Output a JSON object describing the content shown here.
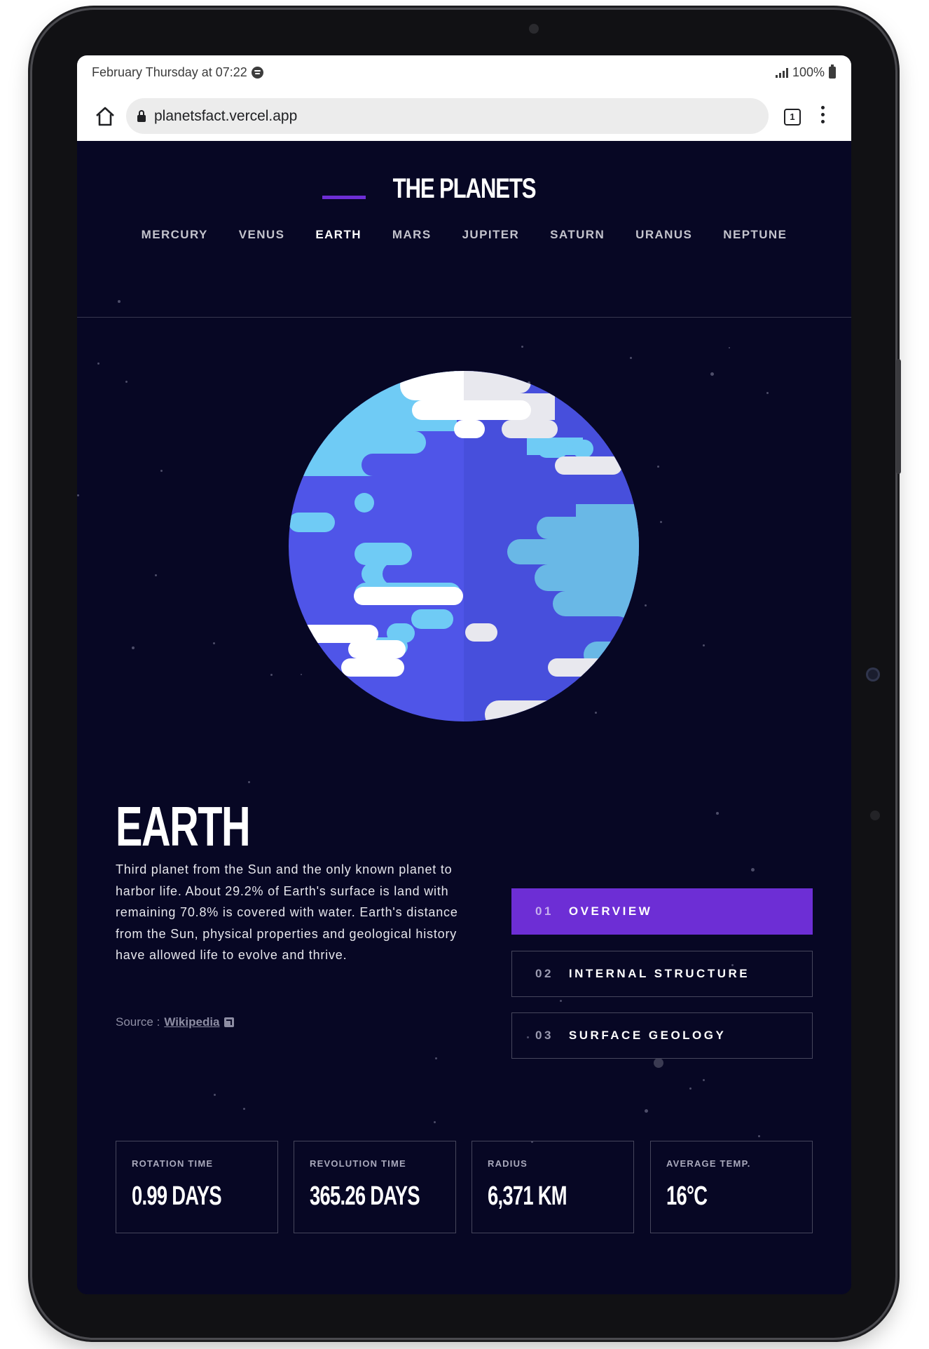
{
  "status_bar": {
    "datetime": "February Thursday at 07:22",
    "battery": "100%",
    "icons": [
      "spotify-icon",
      "signal-icon",
      "battery-icon"
    ]
  },
  "browser": {
    "url": "planetsfact.vercel.app",
    "tab_count": "1",
    "icons": [
      "home-icon",
      "lock-icon",
      "tabs-icon",
      "more-menu-icon"
    ]
  },
  "site": {
    "logo": "THE PLANETS",
    "nav": [
      "MERCURY",
      "VENUS",
      "EARTH",
      "MARS",
      "JUPITER",
      "SATURN",
      "URANUS",
      "NEPTUNE"
    ],
    "active_planet": "EARTH",
    "accent_color": "#6D2ED5",
    "background_color": "#070724"
  },
  "planet": {
    "name": "EARTH",
    "description": "Third planet from the Sun and the only known planet to harbor life. About 29.2% of Earth's surface is land with remaining 70.8% is covered with water. Earth's distance from the Sun, physical properties and geological history have allowed life to evolve and thrive.",
    "source_prefix": "Source :",
    "source_link": "Wikipedia",
    "colors": {
      "ocean": "#4F55E8",
      "land": "#6FCBF5",
      "clouds": "#FFFFFF"
    }
  },
  "tabs": [
    {
      "num": "01",
      "label": "OVERVIEW",
      "active": true
    },
    {
      "num": "02",
      "label": "INTERNAL STRUCTURE",
      "active": false
    },
    {
      "num": "03",
      "label": "SURFACE GEOLOGY",
      "active": false
    }
  ],
  "stats": [
    {
      "label": "ROTATION TIME",
      "value": "0.99 DAYS"
    },
    {
      "label": "REVOLUTION TIME",
      "value": "365.26 DAYS"
    },
    {
      "label": "RADIUS",
      "value": "6,371 KM"
    },
    {
      "label": "AVERAGE TEMP.",
      "value": "16°C"
    }
  ]
}
